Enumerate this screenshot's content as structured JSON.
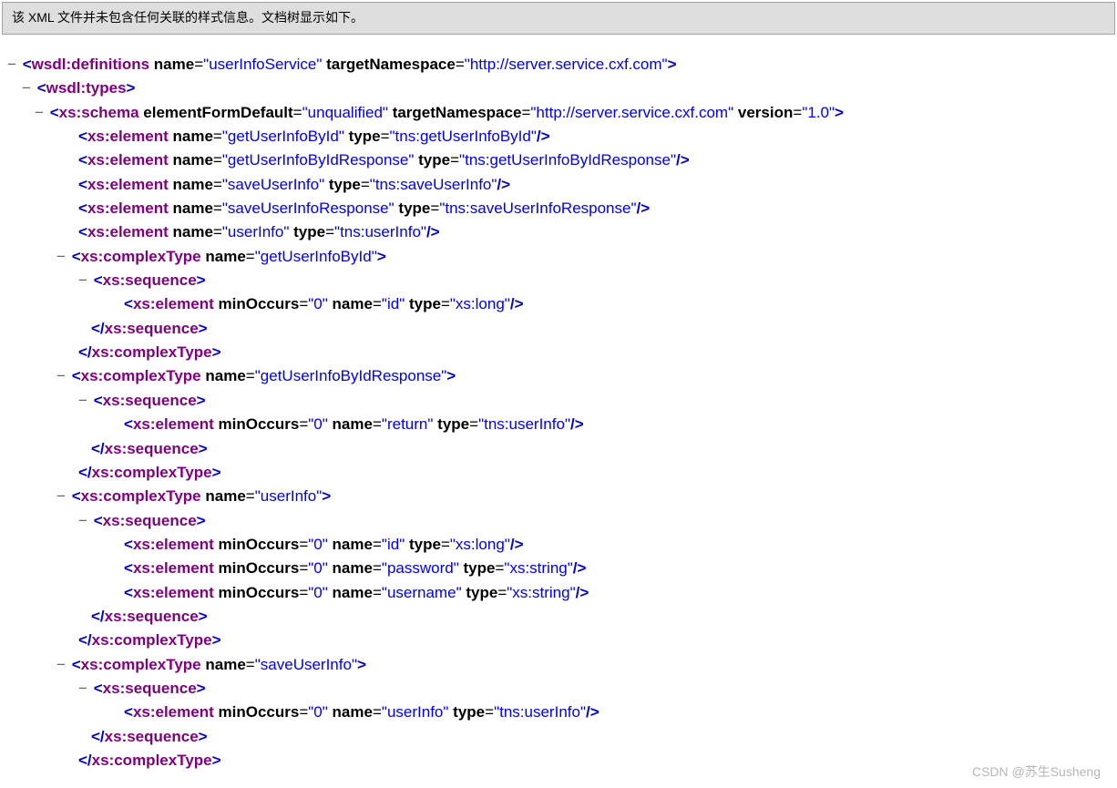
{
  "notice": "该 XML 文件并未包含任何关联的样式信息。文档树显示如下。",
  "watermark": "CSDN @苏生Susheng",
  "p": {
    "lt": "<",
    "gt": ">",
    "sc": "/>",
    "ct": "</",
    "eq": "=",
    "q": "\"",
    "dash": "−"
  },
  "t": {
    "wsdl_definitions": "wsdl:definitions",
    "wsdl_types": "wsdl:types",
    "xs_schema": "xs:schema",
    "xs_element": "xs:element",
    "xs_complexType": "xs:complexType",
    "xs_sequence": "xs:sequence"
  },
  "a": {
    "name": "name",
    "targetNamespace": "targetNamespace",
    "elementFormDefault": "elementFormDefault",
    "version": "version",
    "type": "type",
    "minOccurs": "minOccurs"
  },
  "v": {
    "userInfoService": "userInfoService",
    "ns": "http://server.service.cxf.com",
    "unqualified": "unqualified",
    "v10": "1.0",
    "getUserInfoById": "getUserInfoById",
    "tns_getUserInfoById": "tns:getUserInfoById",
    "getUserInfoByIdResponse": "getUserInfoByIdResponse",
    "tns_getUserInfoByIdResponse": "tns:getUserInfoByIdResponse",
    "saveUserInfo": "saveUserInfo",
    "tns_saveUserInfo": "tns:saveUserInfo",
    "saveUserInfoResponse": "saveUserInfoResponse",
    "tns_saveUserInfoResponse": "tns:saveUserInfoResponse",
    "userInfo": "userInfo",
    "tns_userInfo": "tns:userInfo",
    "zero": "0",
    "id": "id",
    "xs_long": "xs:long",
    "return": "return",
    "password": "password",
    "username": "username",
    "xs_string": "xs:string"
  }
}
